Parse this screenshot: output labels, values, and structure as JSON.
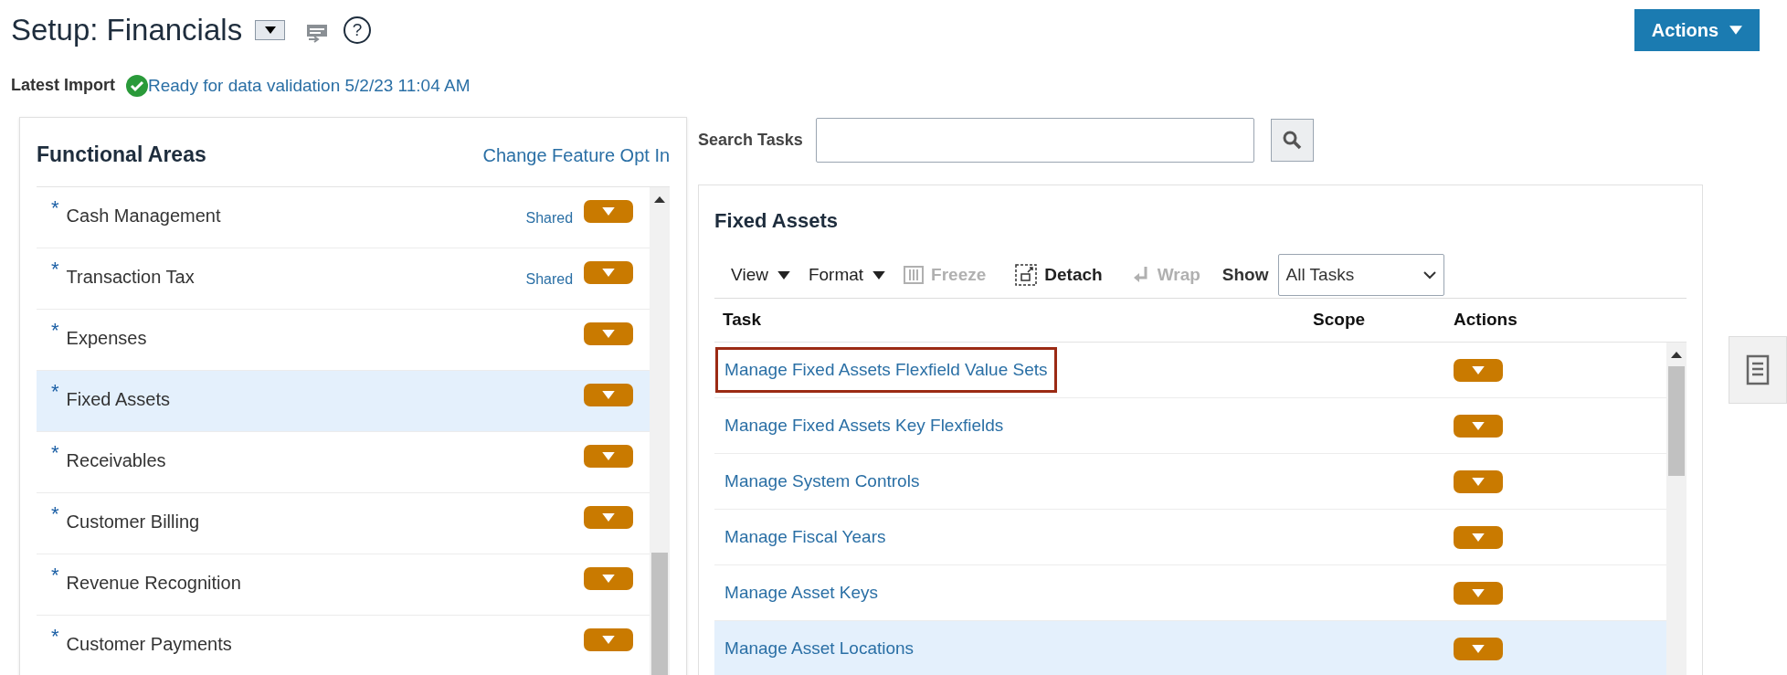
{
  "header": {
    "title": "Setup: Financials",
    "help": "?",
    "actions_button": "Actions"
  },
  "latest_import": {
    "label": "Latest Import",
    "status": "Ready for data validation 5/2/23 11:04 AM"
  },
  "functional_areas": {
    "title": "Functional Areas",
    "link": "Change Feature Opt In",
    "items": [
      {
        "name": "Cash Management",
        "marker": "*",
        "shared": "Shared",
        "selected": false
      },
      {
        "name": "Transaction Tax",
        "marker": "*",
        "shared": "Shared",
        "selected": false
      },
      {
        "name": "Expenses",
        "marker": "*",
        "selected": false
      },
      {
        "name": "Fixed Assets",
        "marker": "*",
        "selected": true
      },
      {
        "name": "Receivables",
        "marker": "*",
        "selected": false
      },
      {
        "name": "Customer Billing",
        "marker": "*",
        "selected": false
      },
      {
        "name": "Revenue Recognition",
        "marker": "*",
        "selected": false
      },
      {
        "name": "Customer Payments",
        "marker": "*",
        "selected": false
      }
    ]
  },
  "search": {
    "label": "Search Tasks"
  },
  "tasks_panel": {
    "title": "Fixed Assets",
    "toolbar": [
      {
        "kind": "menu",
        "label": "View",
        "disabled": false
      },
      {
        "kind": "menu",
        "label": "Format",
        "disabled": false
      },
      {
        "kind": "freeze",
        "label": "Freeze",
        "disabled": true
      },
      {
        "kind": "detach",
        "label": "Detach",
        "disabled": false
      },
      {
        "kind": "wrap",
        "label": "Wrap",
        "disabled": true
      }
    ],
    "show": {
      "label": "Show",
      "value": "All Tasks"
    },
    "columns": [
      "Task",
      "Scope",
      "Actions"
    ],
    "rows": [
      {
        "task": "Manage Fixed Assets Flexfield Value Sets",
        "selected": false,
        "outlined": true
      },
      {
        "task": "Manage Fixed Assets Key Flexfields",
        "selected": false,
        "outlined": false
      },
      {
        "task": "Manage System Controls",
        "selected": false,
        "outlined": false
      },
      {
        "task": "Manage Fiscal Years",
        "selected": false,
        "outlined": false
      },
      {
        "task": "Manage Asset Keys",
        "selected": false,
        "outlined": false
      },
      {
        "task": "Manage Asset Locations",
        "selected": true,
        "outlined": false
      }
    ]
  }
}
